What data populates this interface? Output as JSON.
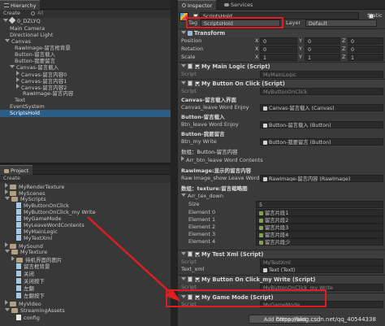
{
  "hierarchy": {
    "tab_label": "Hierarchy",
    "create_label": "Create",
    "search_placeholder": "All",
    "scene_name": "0_DZLYQ",
    "items": [
      {
        "label": "Main Camera"
      },
      {
        "label": "Directional Light"
      },
      {
        "label": "Canvas"
      },
      {
        "label": "RawImage-留言框背景"
      },
      {
        "label": "Button-留言载入"
      },
      {
        "label": "Button-我要留言"
      },
      {
        "label": "Canvas-留言载入"
      },
      {
        "label": "Canvas-留言内容0"
      },
      {
        "label": "Canvas-留言内容1"
      },
      {
        "label": "Canvas-留言内容2"
      },
      {
        "label": "RawImage-留言内容"
      },
      {
        "label": "Text"
      },
      {
        "label": "EventSystem"
      },
      {
        "label": "ScriptsHold"
      }
    ]
  },
  "project": {
    "tab_label": "Project",
    "create_label": "Create",
    "items": [
      {
        "label": "MyRenderTexture"
      },
      {
        "label": "MyScenes"
      },
      {
        "label": "MyScripts"
      },
      {
        "label": "MyButtonOnClick"
      },
      {
        "label": "MyButtonOnClick_my Write"
      },
      {
        "label": "MyGameMode"
      },
      {
        "label": "MyLeaveWordContents"
      },
      {
        "label": "MyMainLogic"
      },
      {
        "label": "MyTextXml"
      },
      {
        "label": "MySound"
      },
      {
        "label": "MyTexture"
      },
      {
        "label": "待机界面的图片"
      },
      {
        "label": "留言框背景"
      },
      {
        "label": "关闭"
      },
      {
        "label": "关闭按下"
      },
      {
        "label": "左翻"
      },
      {
        "label": "左翻按下"
      },
      {
        "label": "MyVideo"
      },
      {
        "label": "StreamingAssets"
      },
      {
        "label": "config"
      }
    ]
  },
  "inspector": {
    "tab_label": "Inspector",
    "services_tab_label": "Services",
    "object_name": "ScriptsHold",
    "static_label": "Static",
    "tag_label": "Tag",
    "tag_value": "ScriptsHold",
    "layer_label": "Layer",
    "layer_value": "Default",
    "transform": {
      "title": "Transform",
      "position_label": "Position",
      "rotation_label": "Rotation",
      "scale_label": "Scale",
      "x": "X",
      "y": "Y",
      "z": "Z",
      "position": [
        "0",
        "0",
        "0"
      ],
      "rotation": [
        "0",
        "0",
        "0"
      ],
      "scale": [
        "1",
        "1",
        "1"
      ]
    },
    "main_logic": {
      "title": "My Main Logic (Script)",
      "script_label": "Script",
      "script_value": "MyMainLogic"
    },
    "button_onclick": {
      "title": "My Button On Click (Script)",
      "script_label": "Script",
      "script_value": "MyButtonOnClick",
      "canvas_section": "Canvas-留言载入界面",
      "canvas_leave_label": "Canvas_leave Word Enjoy",
      "canvas_leave_value": "Canvas-留言载入 (Canvas)",
      "button_section": "Button-留言载入",
      "btn_leave_label": "Btn_leave Word Enjoy",
      "btn_leave_value": "Button-留言载入 (Button)",
      "button_write_section": "Button-我要留言",
      "btn_write_label": "Btn_my Write",
      "btn_write_value": "Button-我要留言 (Button)",
      "array_section": "数组：Button-留言内容",
      "arr_btn_label": "Arr_btn_leave Word Contents",
      "rawimage_section": "RawImage:显示的留言内容",
      "raw_image_label": "Raw Image_show Leave Word",
      "raw_image_value": "RawImage-留言内容 (RawImage)",
      "texture_section": "数组：texture:留言缩略图",
      "arr_tex_label": "Arr_tex_down",
      "size_label": "Size",
      "size_value": "5",
      "elements": [
        {
          "label": "Element 0",
          "value": "留言片段1"
        },
        {
          "label": "Element 1",
          "value": "留言片段2"
        },
        {
          "label": "Element 2",
          "value": "留言片段3"
        },
        {
          "label": "Element 3",
          "value": "留言片段4"
        },
        {
          "label": "Element 4",
          "value": "留言片段少"
        }
      ]
    },
    "text_xml": {
      "title": "My Test Xml (Script)",
      "script_label": "Script",
      "script_value": "MyTestXml",
      "text_xml_label": "Text_xml",
      "text_xml_value": "Text (Text)"
    },
    "button_mywrite": {
      "title": "My Button On Click_my Write (Script)",
      "script_label": "Script",
      "script_value": "MyButtonOnClick_my Write"
    },
    "game_mode": {
      "title": "My Game Mode (Script)",
      "script_label": "Script",
      "script_value": "MyGameMode"
    },
    "add_component": "Add Component"
  },
  "watermark": "https://blog.csdn.net/qq_40544338"
}
